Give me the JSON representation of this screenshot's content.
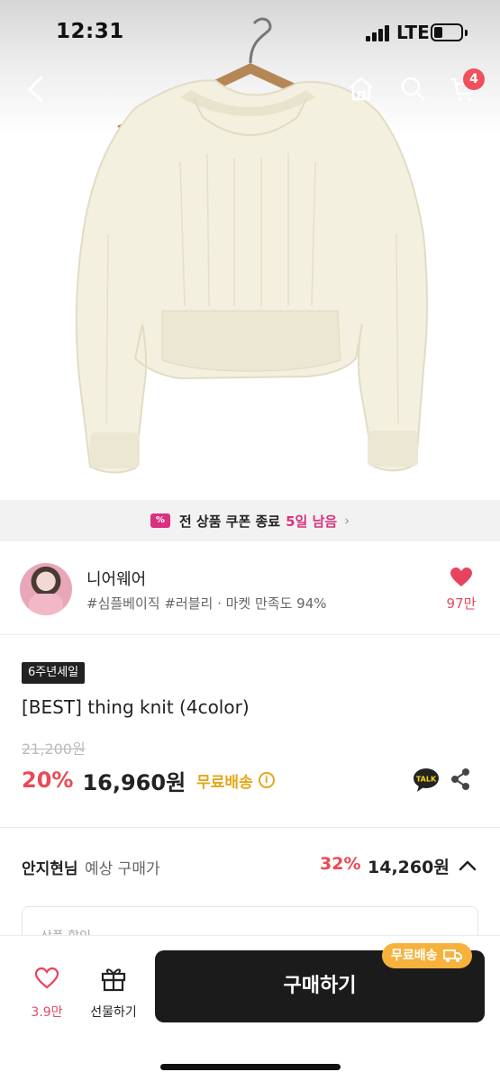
{
  "status_bar": {
    "time": "12:31",
    "network": "LTE"
  },
  "header": {
    "cart_count": "4"
  },
  "coupon_banner": {
    "text": "전 상품 쿠폰 종료",
    "days_left": "5일 남음",
    "arrow": "›"
  },
  "shop": {
    "name": "니어웨어",
    "tags": "#심플베이직 #러블리 · 마켓 만족도 94%",
    "like_count": "97만"
  },
  "product": {
    "event_badge": "6주년세일",
    "title": "[BEST] thing knit (4color)",
    "original_price": "21,200원",
    "discount": "20%",
    "sale_price": "16,960원",
    "shipping": "무료배송",
    "info_mark": "i"
  },
  "expected_price": {
    "user_name": "안지현님",
    "label": "예상 구매가",
    "discount": "32%",
    "price": "14,260원"
  },
  "detail_card": {
    "label": "상품 할인"
  },
  "bottom_bar": {
    "like_count": "3.9만",
    "gift_label": "선물하기",
    "buy_label": "구매하기",
    "free_ship_pill": "무료배송"
  },
  "colors": {
    "accent_red": "#ea4a55",
    "coupon_pink": "#d9317f",
    "shipping_gold": "#e5a71a",
    "buy_button": "#1b1b1b"
  }
}
